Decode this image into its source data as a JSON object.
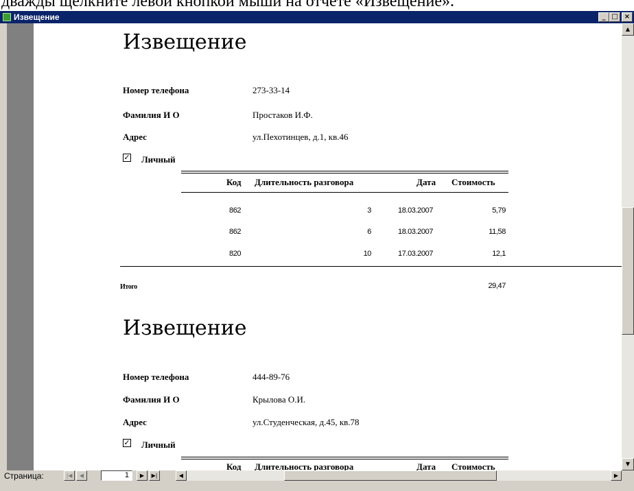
{
  "caption_text": "дважды щелкните левой кнопкой мыши на отчете «Извещение».",
  "window": {
    "title": "Извещение",
    "minimize": "_",
    "maximize": "□",
    "close": "×"
  },
  "notices": [
    {
      "title": "Извещение",
      "phone_label": "Номер телефона",
      "phone": "273-33-14",
      "name_label": "Фамилия И О",
      "name": "Простаков И.Ф.",
      "address_label": "Адрес",
      "address": "ул.Пехотинцев, д.1, кв.46",
      "personal_label": "Личный",
      "personal_checked": "✓",
      "columns": [
        "Код",
        "Длительность разговора",
        "Дата",
        "Стоимость"
      ],
      "rows": [
        [
          "862",
          "3",
          "18.03.2007",
          "5,79"
        ],
        [
          "862",
          "6",
          "18.03.2007",
          "11,58"
        ],
        [
          "820",
          "10",
          "17.03.2007",
          "12,1"
        ]
      ],
      "total_label": "Итого",
      "total": "29,47"
    },
    {
      "title": "Извещение",
      "phone_label": "Номер телефона",
      "phone": "444-89-76",
      "name_label": "Фамилия И О",
      "name": "Крылова О.И.",
      "address_label": "Адрес",
      "address": "ул.Студенческая, д.45, кв.78",
      "personal_label": "Личный",
      "personal_checked": "✓",
      "columns": [
        "Код",
        "Длительность разговора",
        "Дата",
        "Стоимость"
      ]
    }
  ],
  "statusbar": {
    "page_label": "Страница:",
    "page_number": "1",
    "first_icon": "first-record-icon",
    "prev_icon": "prev-record-icon",
    "next_icon": "next-record-icon",
    "last_icon": "last-record-icon"
  },
  "colors": {
    "titlebar": "#0a246a",
    "chrome": "#d4d0c8",
    "margin": "#808080"
  }
}
